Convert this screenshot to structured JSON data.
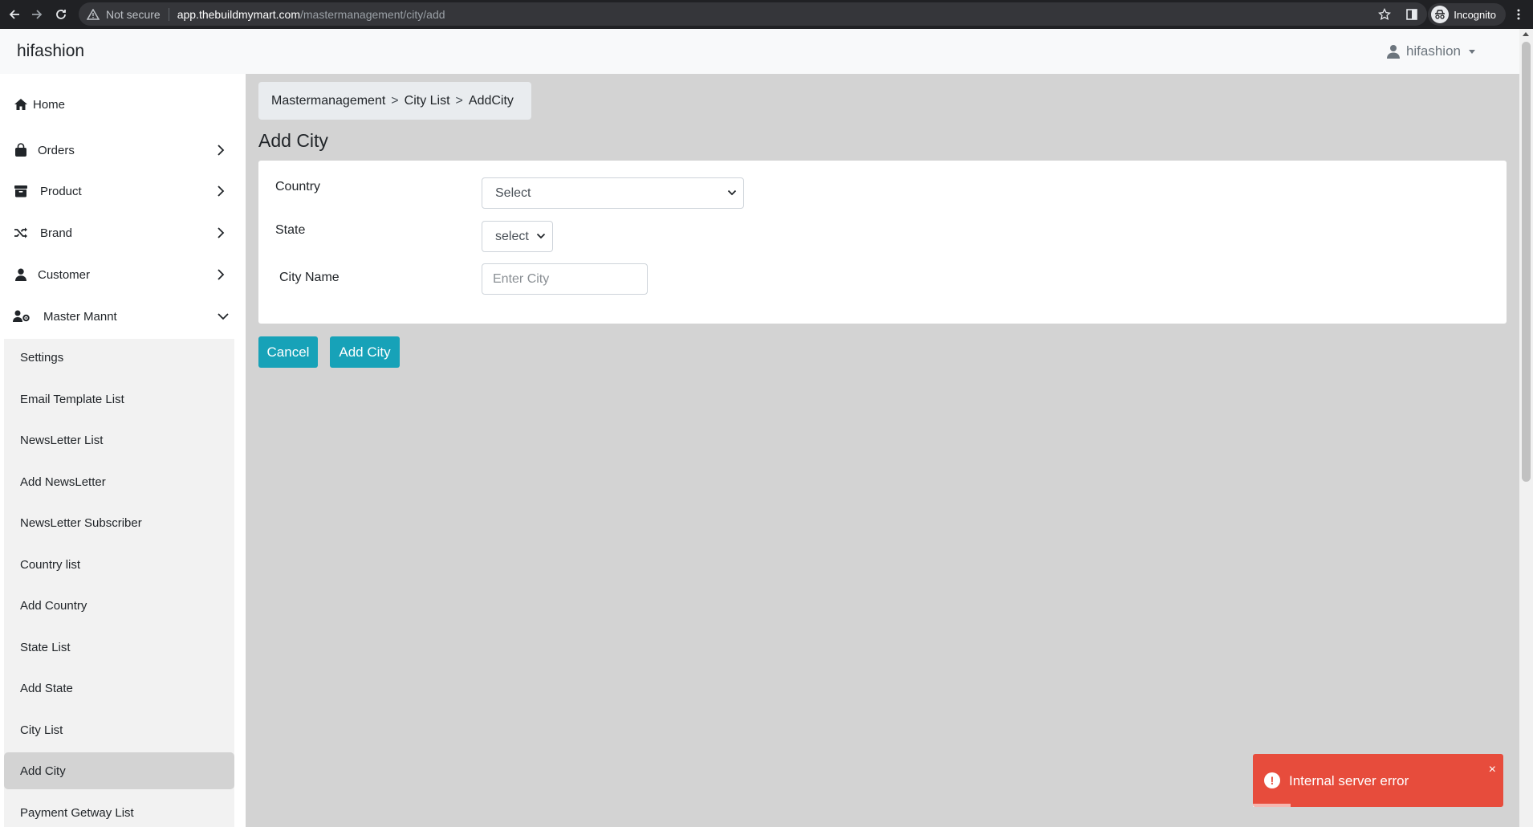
{
  "browser": {
    "security_label": "Not secure",
    "url_host": "app.thebuildmymart.com",
    "url_path": "/mastermanagement/city/add",
    "profile_label": "Incognito"
  },
  "header": {
    "brand": "hifashion",
    "user": "hifashion"
  },
  "sidebar": {
    "items": [
      {
        "label": "Home",
        "icon": "home-icon"
      },
      {
        "label": "Orders",
        "icon": "shopping-bag-icon"
      },
      {
        "label": "Product",
        "icon": "archive-box-icon"
      },
      {
        "label": "Brand",
        "icon": "shuffle-icon"
      },
      {
        "label": "Customer",
        "icon": "user-icon"
      },
      {
        "label": "Master Mannt",
        "icon": "user-gear-icon"
      }
    ],
    "submenu": [
      "Settings",
      "Email Template List",
      "NewsLetter List",
      "Add NewsLetter",
      "NewsLetter Subscriber",
      "Country list",
      "Add Country",
      "State List",
      "Add State",
      "City List",
      "Add City",
      "Payment Getway List"
    ],
    "active_submenu": "Add City"
  },
  "breadcrumb": {
    "items": [
      "Mastermanagement",
      "City List",
      "AddCity"
    ],
    "separator": ">"
  },
  "page_title": "Add City",
  "form": {
    "country_label": "Country",
    "country_value": "Select",
    "state_label": "State",
    "state_value": "select",
    "city_label": "City Name",
    "city_placeholder": "Enter City"
  },
  "buttons": {
    "cancel": "Cancel",
    "add": "Add City"
  },
  "toast": {
    "message": "Internal server error",
    "close": "×",
    "progress": 0.15
  },
  "colors": {
    "accent": "#17a2b8",
    "error": "#e74c3c",
    "main_bg": "#d3d3d3"
  }
}
